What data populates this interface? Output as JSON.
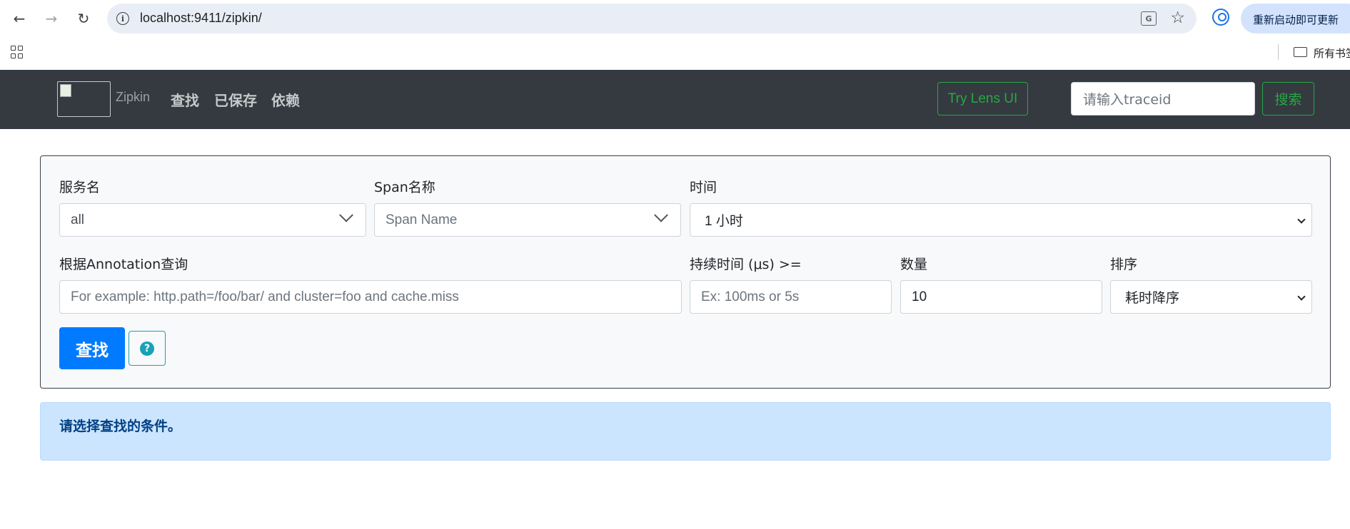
{
  "browser": {
    "url": "localhost:9411/zipkin/",
    "update_label": "重新启动即可更新",
    "bookmarks_folder": "所有书签"
  },
  "navbar": {
    "brand": "Zipkin",
    "links": [
      "查找",
      "已保存",
      "依赖"
    ],
    "lens_button": "Try Lens UI",
    "traceid_placeholder": "请输入traceid",
    "search_button": "搜索"
  },
  "form": {
    "service_label": "服务名",
    "service_value": "all",
    "span_label": "Span名称",
    "span_placeholder": "Span Name",
    "time_label": "时间",
    "time_value": "1 小时",
    "annotation_label": "根据Annotation查询",
    "annotation_placeholder": "For example: http.path=/foo/bar/ and cluster=foo and cache.miss",
    "duration_label": "持续时间 (μs) >=",
    "duration_placeholder": "Ex: 100ms or 5s",
    "limit_label": "数量",
    "limit_value": "10",
    "sort_label": "排序",
    "sort_value": "耗时降序",
    "find_button": "查找",
    "help_glyph": "?"
  },
  "alert": {
    "message": "请选择查找的条件。"
  },
  "colors": {
    "navbar_bg": "#343a40",
    "primary": "#007bff",
    "success": "#28a745",
    "info": "#17a2b8",
    "alert_bg": "#cce5ff"
  }
}
